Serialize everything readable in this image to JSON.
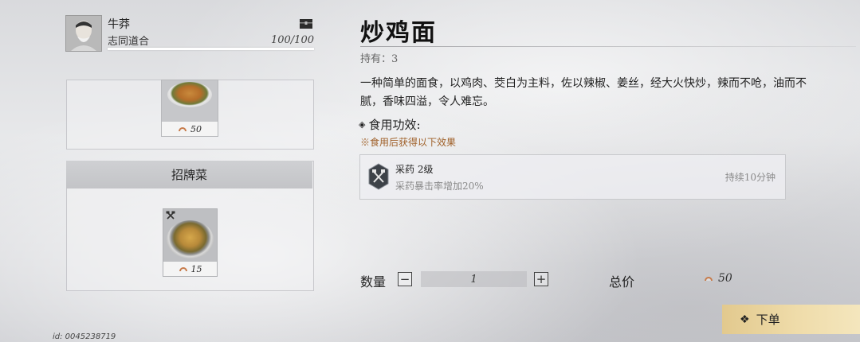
{
  "profile": {
    "name": "牛莽",
    "title": "志同道合",
    "count": "100/100",
    "progress": 1.0
  },
  "list": {
    "top_card": {
      "price": "50"
    },
    "section_title": "招牌菜",
    "featured_card": {
      "price": "15"
    }
  },
  "detail": {
    "name": "炒鸡面",
    "owned": "持有：3",
    "description": "一种简单的面食，以鸡肉、茭白为主料，佐以辣椒、姜丝，经大火快炒，辣而不呛，油而不腻，香味四溢，令人难忘。",
    "effect_heading": "食用功效:",
    "effect_note": "※食用后获得以下效果",
    "effect": {
      "name": "采药 2级",
      "desc": "采药暴击率增加20%",
      "duration": "持续10分钟"
    }
  },
  "purchase": {
    "qty_label": "数量",
    "qty_value": "1",
    "minus": "−",
    "plus": "+",
    "total_label": "总价",
    "total_value": "50",
    "order_label": "下单"
  },
  "footer": {
    "uid": "id: 0045238719"
  },
  "colors": {
    "accent_gold": "#efdcaa",
    "note_orange": "#a0612a"
  },
  "icons": [
    "chest-icon",
    "coin-icon",
    "herb-tool-icon",
    "diamond-icon"
  ]
}
